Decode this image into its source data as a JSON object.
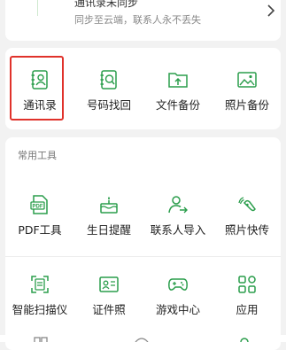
{
  "sync": {
    "title": "通讯录未同步",
    "subtitle": "同步至云端，联系人永不丢失"
  },
  "backup": {
    "items": [
      {
        "label": "通讯录",
        "icon": "contact-book-icon"
      },
      {
        "label": "号码找回",
        "icon": "number-recovery-icon"
      },
      {
        "label": "文件备份",
        "icon": "folder-upload-icon"
      },
      {
        "label": "照片备份",
        "icon": "photo-icon"
      }
    ]
  },
  "tools": {
    "section_title": "常用工具",
    "items": [
      {
        "label": "PDF工具",
        "icon": "pdf-icon"
      },
      {
        "label": "生日提醒",
        "icon": "birthday-cake-icon"
      },
      {
        "label": "联系人导入",
        "icon": "contact-import-icon"
      },
      {
        "label": "照片快传",
        "icon": "photo-transfer-icon"
      },
      {
        "label": "智能扫描仪",
        "icon": "scanner-icon"
      },
      {
        "label": "证件照",
        "icon": "id-photo-icon"
      },
      {
        "label": "游戏中心",
        "icon": "gamepad-icon"
      },
      {
        "label": "应用",
        "icon": "apps-grid-icon"
      }
    ]
  },
  "colors": {
    "accent": "#2a9d4b",
    "highlight": "#e0322b"
  }
}
